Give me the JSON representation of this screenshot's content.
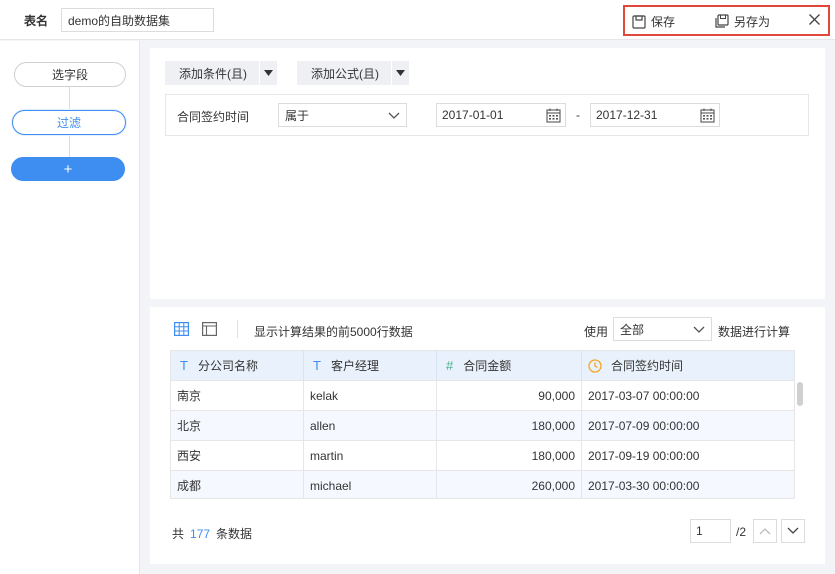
{
  "header": {
    "table_name_label": "表名",
    "table_name_value": "demo的自助数据集",
    "save_label": "保存",
    "save_as_label": "另存为"
  },
  "sidebar": {
    "steps": [
      {
        "label": "选字段"
      },
      {
        "label": "过滤"
      },
      {
        "label": "+"
      }
    ]
  },
  "filter": {
    "add_condition_label": "添加条件(且)",
    "add_formula_label": "添加公式(且)",
    "condition": {
      "field": "合同签约时间",
      "operator": "属于",
      "start_date": "2017-01-01",
      "separator": "-",
      "end_date": "2017-12-31"
    }
  },
  "result": {
    "info_text": "显示计算结果的前5000行数据",
    "use_label": "使用",
    "use_value": "全部",
    "calc_label": "数据进行计算",
    "columns": [
      {
        "type_icon": "T",
        "label": "分公司名称"
      },
      {
        "type_icon": "T",
        "label": "客户经理"
      },
      {
        "type_icon": "#",
        "label": "合同金额"
      },
      {
        "type_icon": "clock",
        "label": "合同签约时间"
      }
    ],
    "rows": [
      [
        "南京",
        "kelak",
        "90,000",
        "2017-03-07 00:00:00"
      ],
      [
        "北京",
        "allen",
        "180,000",
        "2017-07-09 00:00:00"
      ],
      [
        "西安",
        "martin",
        "180,000",
        "2017-09-19 00:00:00"
      ],
      [
        "成都",
        "michael",
        "260,000",
        "2017-03-30 00:00:00"
      ]
    ],
    "total_prefix": "共",
    "total_count": "177",
    "total_suffix": "条数据",
    "page_current": "1",
    "page_total": "/2"
  },
  "colors": {
    "accent": "#3d8ef0",
    "highlight_border": "#e0483c",
    "header_bg": "#e8f1fc",
    "date_icon": "#f5a623",
    "type_text_icon": "#3d8ef0",
    "type_number_icon": "#4caf8a"
  },
  "icons": {
    "save": "floppy-disk-icon",
    "save_as": "copy-icon",
    "close": "close-icon",
    "dropdown": "caret-down-icon",
    "calendar": "calendar-icon",
    "table_view": "grid-icon",
    "card_view": "card-icon",
    "prev_page": "chevron-up-icon",
    "next_page": "chevron-down-icon"
  }
}
